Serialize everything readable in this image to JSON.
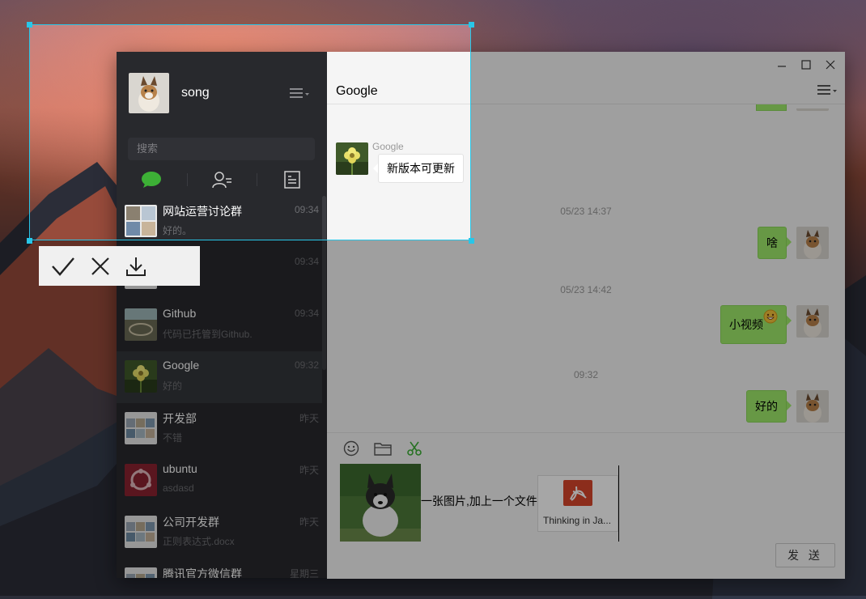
{
  "user": {
    "name": "song"
  },
  "sidebar": {
    "search_placeholder": "搜索",
    "tabs": [
      {
        "icon": "chat-bubble-icon",
        "active": true
      },
      {
        "icon": "contacts-icon",
        "active": false
      },
      {
        "icon": "favorites-icon",
        "active": false
      }
    ],
    "chats": [
      {
        "name": "网站运营讨论群",
        "time": "09:34",
        "preview": "好的。"
      },
      {
        "name": "",
        "time": "09:34",
        "preview": ""
      },
      {
        "name": "Github",
        "time": "09:34",
        "preview": "代码已托管到Github."
      },
      {
        "name": "Google",
        "time": "09:32",
        "preview": "好的"
      },
      {
        "name": "开发部",
        "time": "昨天",
        "preview": "不错"
      },
      {
        "name": "ubuntu",
        "time": "昨天",
        "preview": "asdasd"
      },
      {
        "name": "公司开发群",
        "time": "昨天",
        "preview": "正则表达式.docx"
      },
      {
        "name": "腾讯官方微信群",
        "time": "星期三",
        "preview": ""
      }
    ]
  },
  "conversation": {
    "title": "Google",
    "messages": {
      "google_sender": "Google",
      "google_msg": "新版本可更新",
      "time1": "05/23 14:37",
      "msg1": "啥",
      "time2": "05/23 14:42",
      "msg2": "小视频",
      "time3": "09:32",
      "msg3": "好的"
    },
    "composer": {
      "text": "一张图片,加上一个文件",
      "file_name": "Thinking in Ja...",
      "send_label": "发 送"
    }
  },
  "colors": {
    "selection": "#28c6e8",
    "bubble_self": "#9eea6a",
    "accent_green": "#3db036",
    "pdf_red": "#d8462c"
  }
}
